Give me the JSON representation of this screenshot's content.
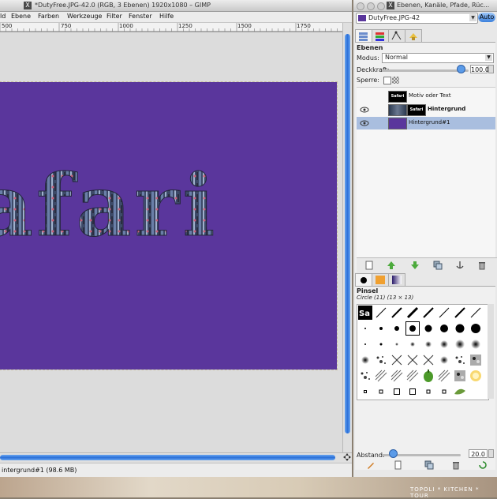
{
  "main_window": {
    "title": "*DutyFree.JPG-42.0 (RGB, 3 Ebenen) 1920x1080 – GIMP",
    "menu": [
      "ld",
      "Ebene",
      "Farben",
      "Werkzeuge",
      "Filter",
      "Fenster",
      "Hilfe"
    ],
    "ruler_labels": [
      "500",
      "750",
      "1000",
      "1250",
      "1500",
      "1750"
    ],
    "canvas_text": "afari",
    "canvas_color": "#5a369c",
    "status": "intergrund#1 (98.6 MB)"
  },
  "dock": {
    "title": "Ebenen, Kanäle, Pfade, Rüc...",
    "image_selector": "DutyFree.JPG-42",
    "auto_button": "Auto",
    "layers": {
      "heading": "Ebenen",
      "mode_label": "Modus:",
      "mode_value": "Normal",
      "opacity_label": "Deckkraft:",
      "opacity_value": "100.0",
      "lock_label": "Sperre:",
      "items": [
        {
          "name": "Motiv oder Text",
          "visible": false,
          "thumb_text": "Safari",
          "bold": false,
          "selected": false
        },
        {
          "name": "Hintergrund",
          "visible": true,
          "thumb_text": "Safari",
          "bold": true,
          "selected": false
        },
        {
          "name": "Hintergrund#1",
          "visible": true,
          "thumb_text": "",
          "bold": false,
          "selected": true
        }
      ]
    },
    "brushes": {
      "heading": "Pinsel",
      "selected_brush": "Circle (11) (13 × 13)",
      "spacing_label": "Abstand:",
      "spacing_value": "20.0"
    }
  },
  "footer": "TOPOLI * KITCHEN * TOUR"
}
